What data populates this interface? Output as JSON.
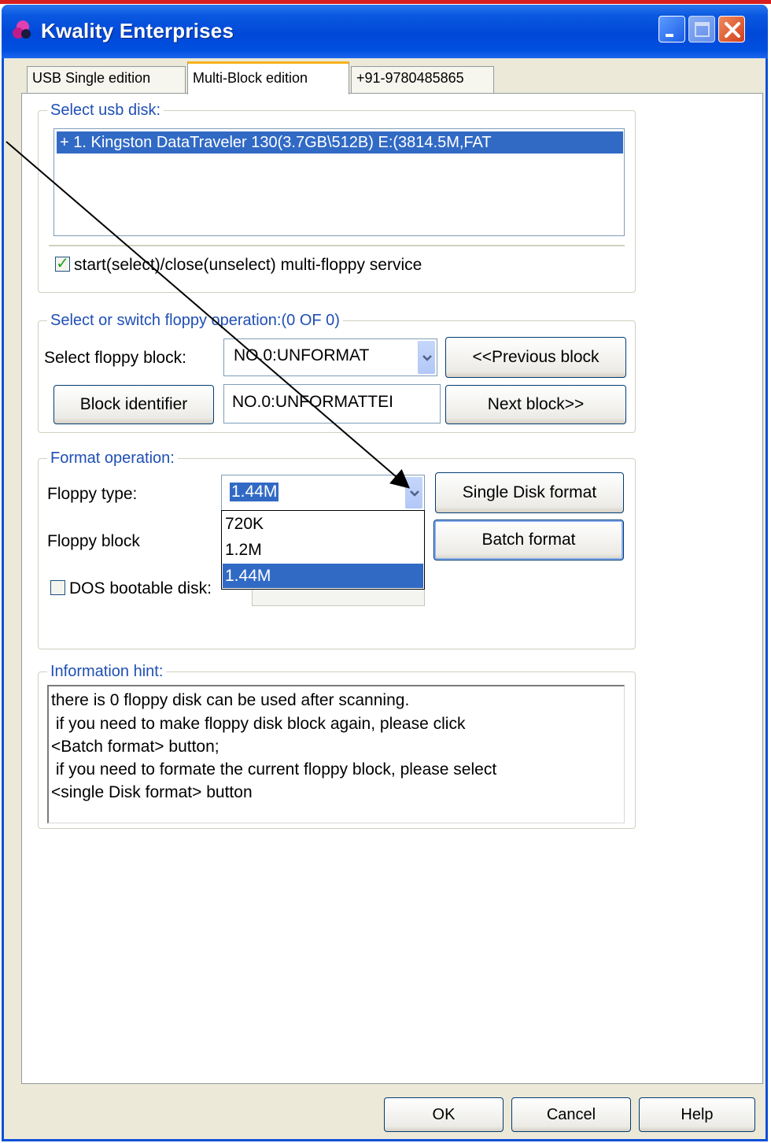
{
  "window": {
    "title": "Kwality Enterprises"
  },
  "tabs": [
    {
      "label": "USB  Single  edition"
    },
    {
      "label": "Multi-Block  edition"
    },
    {
      "label": "+91-9780485865"
    }
  ],
  "usb_group": {
    "legend": "Select usb disk:",
    "items": [
      "+ 1. Kingston DataTraveler 130(3.7GB\\512B)  E:(3814.5M,FAT"
    ],
    "service_checkbox_label": "start(select)/close(unselect) multi-floppy service",
    "service_checked": true
  },
  "switch_group": {
    "legend": "Select or switch floppy operation:(0 OF 0)",
    "select_label": "Select floppy block:",
    "select_value": "NO.0:UNFORMAT",
    "prev_button": "<<Previous block",
    "identifier_button": "Block identifier",
    "identifier_value": "NO.0:UNFORMATTEI",
    "next_button": "Next block>>"
  },
  "format_group": {
    "legend": "Format operation:",
    "floppy_type_label": "Floppy type:",
    "floppy_type_value": "1.44M",
    "single_format_button": "Single Disk format",
    "floppy_block_label": "Floppy block",
    "batch_format_button": "Batch format",
    "dos_bootable_label": "DOS bootable disk:",
    "dos_bootable_checked": false,
    "dropdown_options": [
      "720K",
      "1.2M",
      "1.44M"
    ],
    "dropdown_selected": "1.44M"
  },
  "hint_group": {
    "legend": "Information hint:",
    "lines": [
      "there is 0 floppy disk can be used after scanning.",
      " if you need to make floppy disk block again, please click",
      "<Batch format> button;",
      " if you need to formate the current floppy block, please select",
      "<single Disk format> button"
    ]
  },
  "footer": {
    "ok": "OK",
    "cancel": "Cancel",
    "help": "Help"
  },
  "colors": {
    "titlebar": "#0048d8",
    "selection": "#316ac5",
    "legend_text": "#1f4fb4",
    "dialog_bg": "#ece9d8"
  }
}
